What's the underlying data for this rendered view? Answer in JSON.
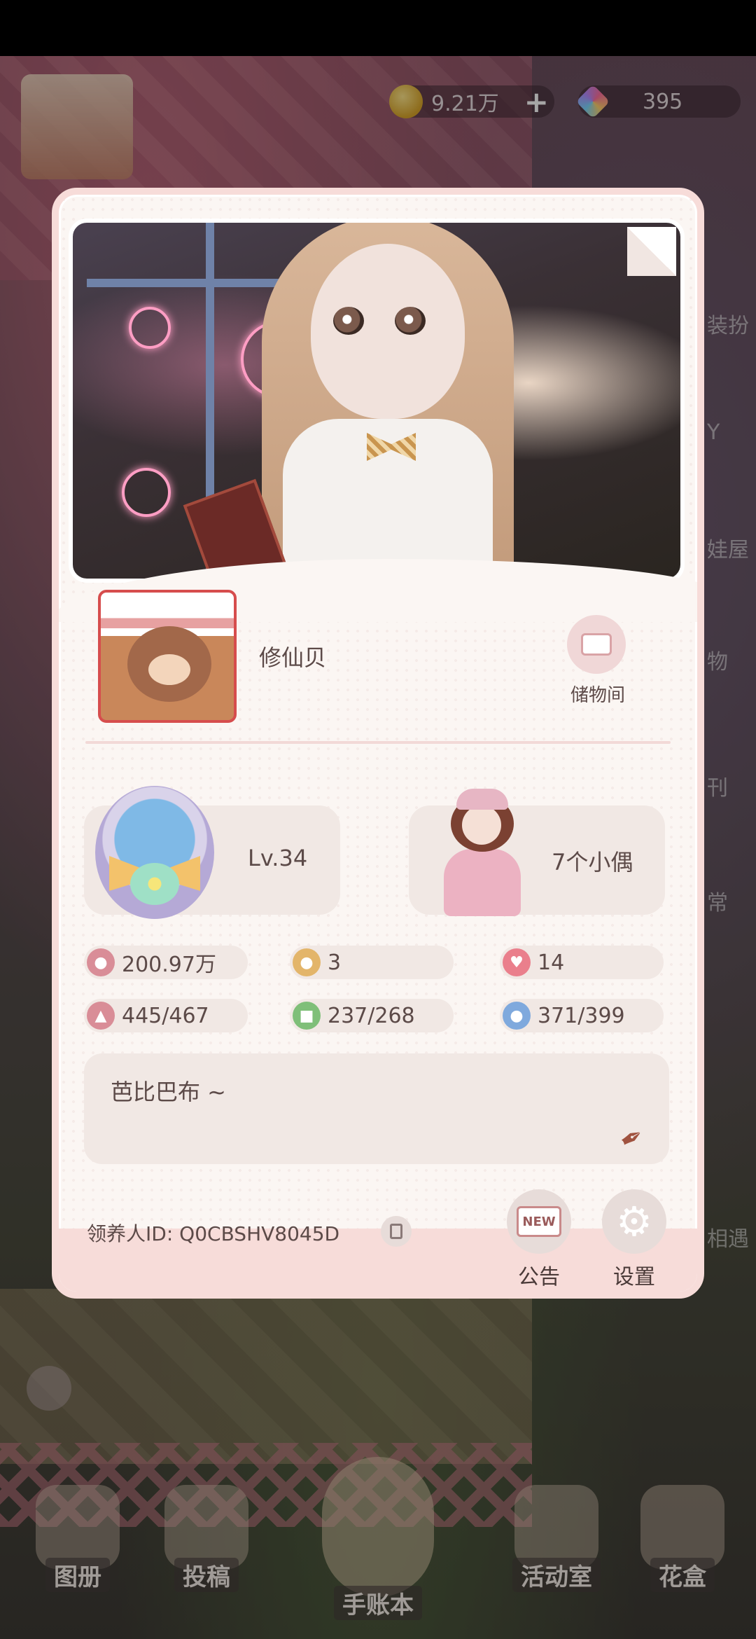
{
  "currency": {
    "coins": "9.21万",
    "gems": "395"
  },
  "profile": {
    "nickname": "修仙贝",
    "storage_label": "储物间",
    "level": "Lv.34",
    "dolls": "7个小偶",
    "stats": [
      {
        "icon": "person-icon",
        "value": "200.97万"
      },
      {
        "icon": "footprint-icon",
        "value": "3"
      },
      {
        "icon": "heart-mail-icon",
        "value": "14"
      },
      {
        "icon": "dress-icon",
        "value": "445/467"
      },
      {
        "icon": "furniture-icon",
        "value": "237/268"
      },
      {
        "icon": "bag-icon",
        "value": "371/399"
      }
    ],
    "signature": "芭比巴布 ~",
    "adopter_id_label": "领养人ID:",
    "adopter_id": "Q0CBSHV8045D"
  },
  "buttons": {
    "notice_tag": "NEW",
    "notice_label": "公告",
    "settings_label": "设置"
  },
  "side_labels": [
    "装扮",
    "Y",
    "娃屋",
    "物",
    "刊",
    "常",
    "相遇"
  ],
  "bottom_nav": [
    "图册",
    "投稿",
    "手账本",
    "活动室",
    "花盒"
  ]
}
